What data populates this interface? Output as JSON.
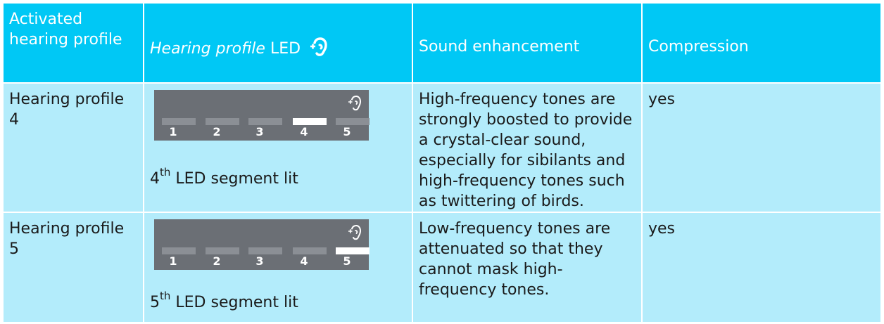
{
  "header": {
    "col1": "Activated hearing profile",
    "col2_italic": "Hearing profile",
    "col2_rest": "LED",
    "col2_icon": "ear-plus-icon",
    "col3": "Sound enhancement",
    "col4": "Compression"
  },
  "rows": [
    {
      "profile": "Hearing profile 4",
      "led_numbers": [
        "1",
        "2",
        "3",
        "4",
        "5"
      ],
      "lit_index": 4,
      "lit_ordinal": "4",
      "lit_suffix": "th",
      "lit_text": "LED segment lit",
      "enhancement": "High-frequency tones are strongly boosted to provide a crystal-clear sound, especially for sibilants and high-frequency tones such as twittering of birds.",
      "compression": "yes"
    },
    {
      "profile": "Hearing profile 5",
      "led_numbers": [
        "1",
        "2",
        "3",
        "4",
        "5"
      ],
      "lit_index": 5,
      "lit_ordinal": "5",
      "lit_suffix": "th",
      "lit_text": "LED segment lit",
      "enhancement": "Low-frequency tones are attenuated so that they cannot mask high-frequency tones.",
      "compression": "yes"
    }
  ],
  "colors": {
    "header_bg": "#00c8f5",
    "body_bg": "#b3ecfb",
    "led_panel": "#6b6f75",
    "led_off": "#8b8f95",
    "led_on": "#ffffff"
  }
}
